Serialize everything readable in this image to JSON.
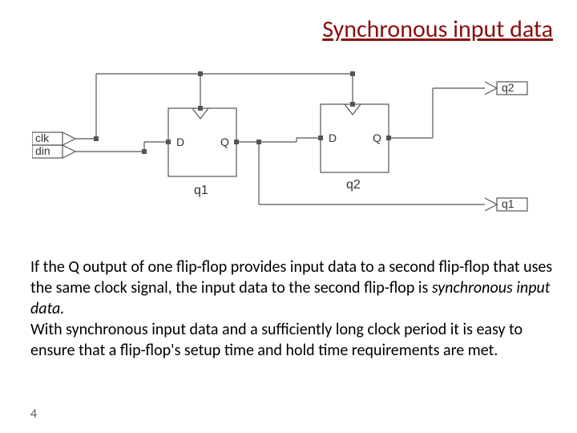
{
  "title": "Synchronous input data",
  "inputs": {
    "clk": "clk",
    "din": "din"
  },
  "flipflops": {
    "q1": {
      "name": "q1",
      "d": "D",
      "q": "Q"
    },
    "q2": {
      "name": "q2",
      "d": "D",
      "q": "Q"
    }
  },
  "outputs": {
    "q1": "q1",
    "q2": "q2"
  },
  "paragraph": {
    "p1a": "If the Q output of one flip-flop provides input data to a second flip-flop that uses the same clock signal, the input data to the second flip-flop is ",
    "p1b": "synchronous input data.",
    "p2": "With synchronous input data and a sufficiently long clock period it is easy to ensure that a flip-flop's setup time and hold time requirements are met."
  },
  "page": "4"
}
